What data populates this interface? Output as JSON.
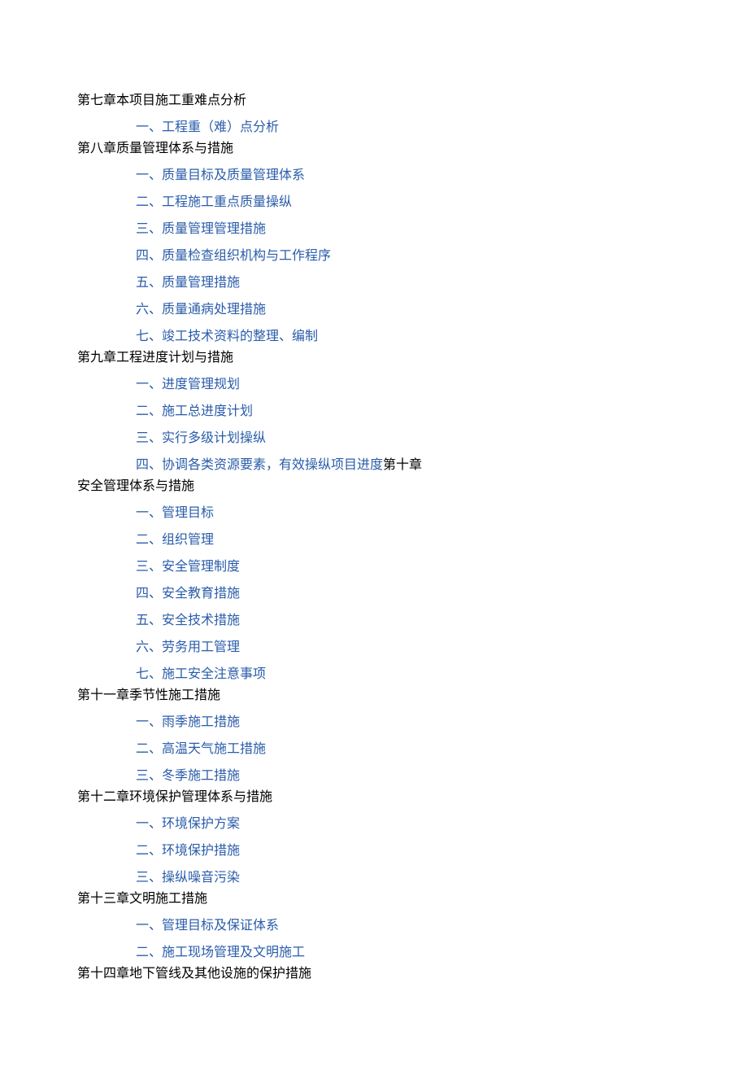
{
  "sections": [
    {
      "title": "第七章本项目施工重难点分析",
      "items": [
        {
          "text": "一、工程重（难）点分析",
          "tight": true
        }
      ]
    },
    {
      "title": "第八章质量管理体系与措施",
      "items": [
        {
          "text": "一、质量目标及质量管理体系"
        },
        {
          "text": "二、工程施工重点质量操纵"
        },
        {
          "text": "三、质量管理管理措施"
        },
        {
          "text": "四、质量检查组织机构与工作程序"
        },
        {
          "text": "五、质量管理措施"
        },
        {
          "text": "六、质量通病处理措施"
        },
        {
          "text": "七、竣工技术资料的整理、编制",
          "tight": true
        }
      ]
    },
    {
      "title": "第九章工程进度计划与措施",
      "items": [
        {
          "text": "一、进度管理规划"
        },
        {
          "text": "二、施工总进度计划"
        },
        {
          "text": "三、实行多级计划操纵"
        },
        {
          "text": "四、协调各类资源要素，有效操纵项目进度",
          "tight": true,
          "inline_suffix": "第十章"
        }
      ]
    },
    {
      "title": "安全管理体系与措施",
      "items": [
        {
          "text": "一、管理目标"
        },
        {
          "text": "二、组织管理"
        },
        {
          "text": "三、安全管理制度"
        },
        {
          "text": "四、安全教育措施"
        },
        {
          "text": "五、安全技术措施"
        },
        {
          "text": "六、劳务用工管理"
        },
        {
          "text": "七、施工安全注意事项",
          "tight": true
        }
      ]
    },
    {
      "title": "第十一章季节性施工措施",
      "items": [
        {
          "text": "一、雨季施工措施"
        },
        {
          "text": "二、高温天气施工措施"
        },
        {
          "text": "三、冬季施工措施",
          "tight": true
        }
      ]
    },
    {
      "title": "第十二章环境保护管理体系与措施",
      "items": [
        {
          "text": "一、环境保护方案"
        },
        {
          "text": "二、环境保护措施"
        },
        {
          "text": "三、操纵噪音污染",
          "tight": true
        }
      ]
    },
    {
      "title": "第十三章文明施工措施",
      "items": [
        {
          "text": "一、管理目标及保证体系"
        },
        {
          "text": "二、施工现场管理及文明施工",
          "tight": true
        }
      ]
    },
    {
      "title": "第十四章地下管线及其他设施的保护措施",
      "items": []
    }
  ]
}
